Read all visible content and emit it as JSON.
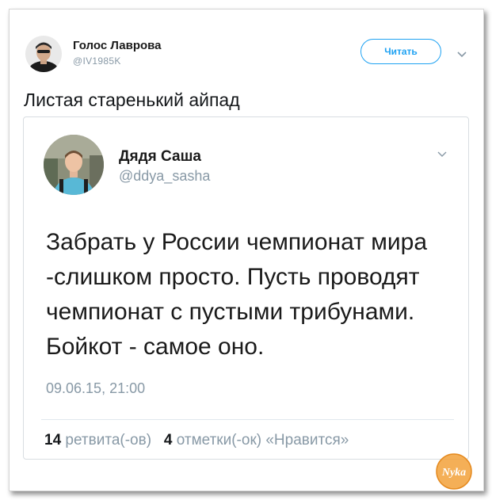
{
  "outer_tweet": {
    "author_name": "Голос Лаврова",
    "author_handle": "@IV1985K",
    "follow_label": "Читать",
    "text": "Листая старенький айпад"
  },
  "quoted_tweet": {
    "author_name": "Дядя Саша",
    "author_handle": "@ddya_sasha",
    "body_lines": [
      "Забрать у России чемпионат мира",
      "-слишком просто. Пусть проводят",
      "чемпионат с пустыми трибунами.",
      "Бойкот - самое оно."
    ],
    "timestamp": "09.06.15, 21:00",
    "retweet_count": "14",
    "retweet_label": "ретвита(-ов)",
    "like_count": "4",
    "like_label": "отметки(-ок) «Нравится»"
  },
  "watermark": {
    "text": "Nyka",
    "color": "#f2a13a"
  },
  "colors": {
    "accent": "#1da1f2",
    "secondary_text": "#8899a6",
    "primary_text": "#14171a"
  }
}
